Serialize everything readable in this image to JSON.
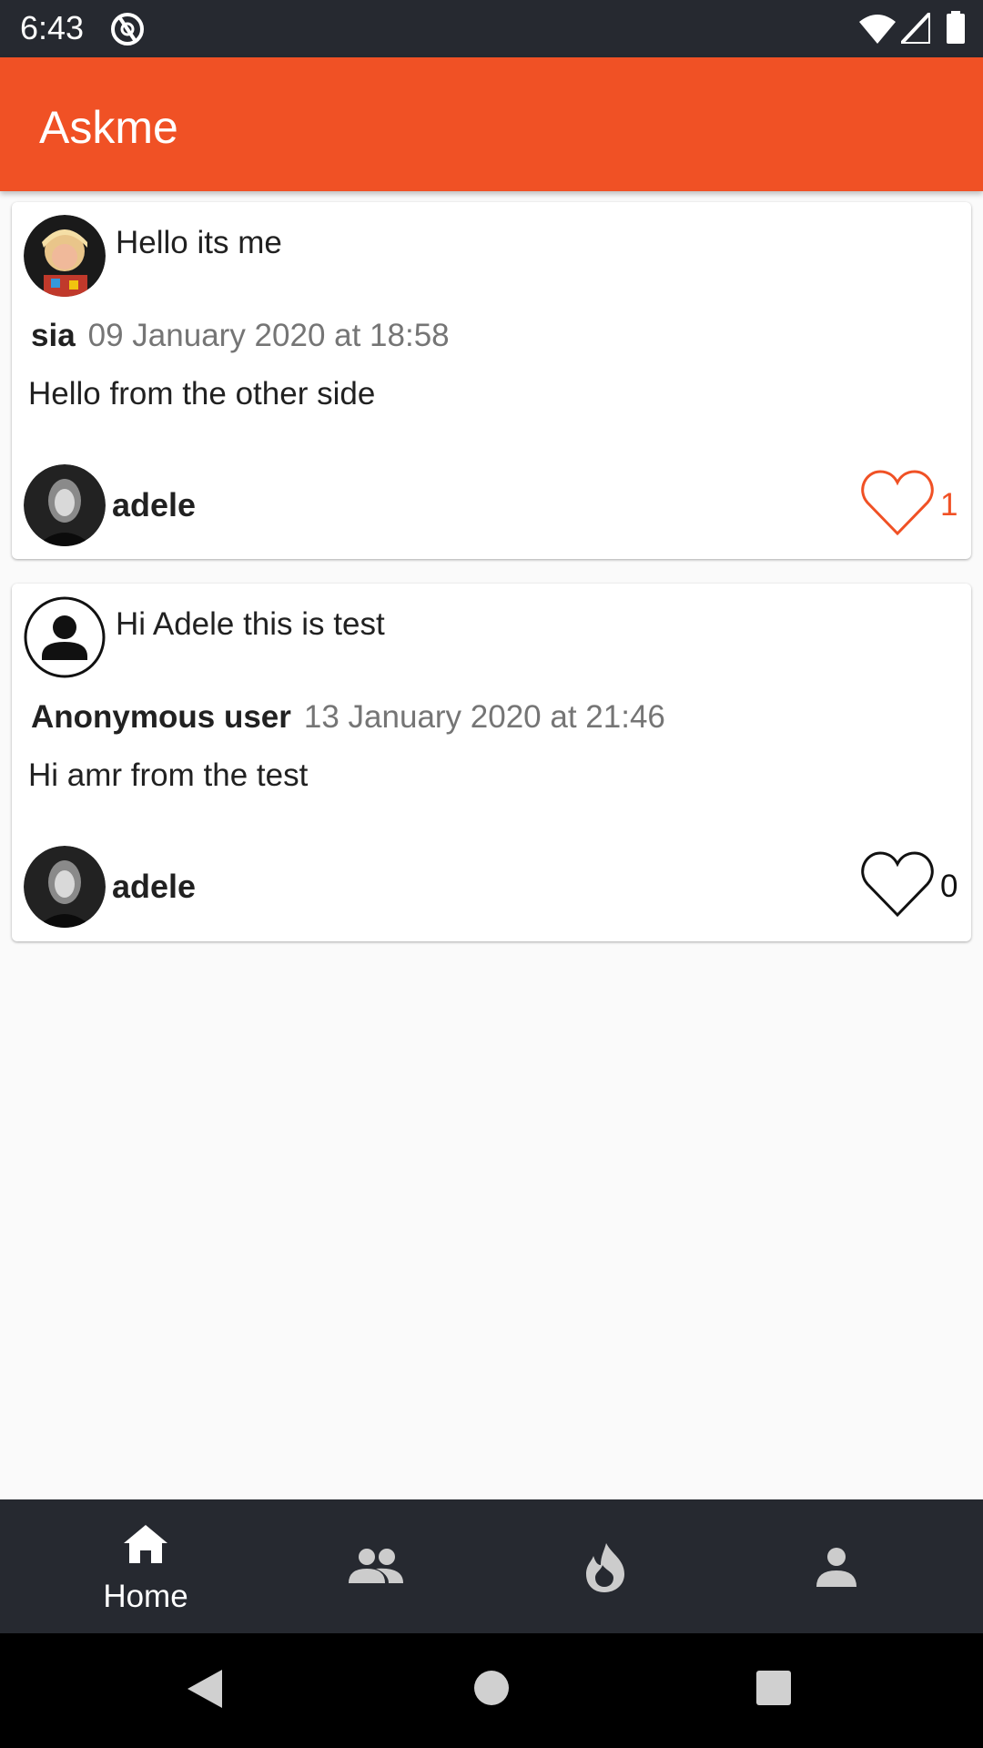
{
  "status_bar": {
    "time": "6:43",
    "icons": [
      "sync-icon",
      "wifi-icon",
      "signal-icon",
      "battery-icon"
    ]
  },
  "app_bar": {
    "title": "Askme"
  },
  "colors": {
    "accent": "#f05125",
    "status_bar": "#262930",
    "bottom_nav": "#262930",
    "like_active": "#f05125",
    "meta_date": "#757575"
  },
  "questions": [
    {
      "question": "Hello its me",
      "author": "sia",
      "date": "09 January 2020 at 18:58",
      "answer": "Hello from the other side",
      "answerer": "adele",
      "likes": "1",
      "liked": true
    },
    {
      "question": "Hi Adele this is test",
      "author": "Anonymous user",
      "date": "13 January 2020 at 21:46",
      "answer": "Hi amr from the test",
      "answerer": "adele",
      "likes": "0",
      "liked": false
    }
  ],
  "bottom_nav": {
    "items": [
      {
        "label": "Home",
        "icon": "home-icon",
        "active": true
      },
      {
        "label": "",
        "icon": "people-icon",
        "active": false
      },
      {
        "label": "",
        "icon": "fire-icon",
        "active": false
      },
      {
        "label": "",
        "icon": "person-icon",
        "active": false
      }
    ]
  },
  "system_nav": {
    "icons": [
      "back-icon",
      "home-circle-icon",
      "recents-icon"
    ]
  }
}
